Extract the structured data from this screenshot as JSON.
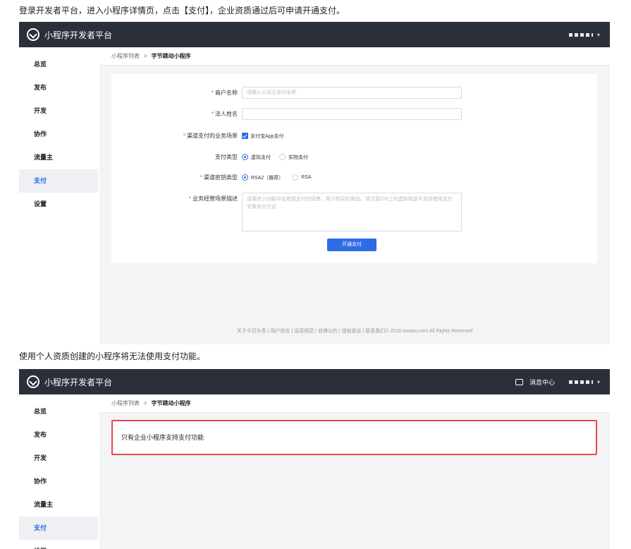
{
  "captions": {
    "first": "登录开发者平台，进入小程序详情页，点击【支付】，企业资质通过后可申请开通支付。",
    "second": "使用个人资质创建的小程序将无法使用支付功能。"
  },
  "brand": "小程序开发者平台",
  "message_center": "消息中心",
  "sidebar": [
    "总览",
    "发布",
    "开发",
    "协作",
    "流量主",
    "支付",
    "设置"
  ],
  "breadcrumb": {
    "list": "小程序列表",
    "sep": ">",
    "current": "字节跳动小程序"
  },
  "form": {
    "merchant_label": "商户名称",
    "merchant_placeholder": "请输入公司主体的全称",
    "legal_label": "法人姓名",
    "legal_value": "",
    "scene_label": "渠道支付的业务场景",
    "scene_option": "支付宝App支付",
    "paytype_label": "支付类型",
    "paytype_options": [
      "虚拟支付",
      "实物支付"
    ],
    "sign_label": "渠道密钥类型",
    "sign_options": [
      "RSA2（推荐）",
      "RSA"
    ],
    "desc_label": "业务经营场景描述",
    "desc_placeholder": "请描述小功能中会使用支付的场景、用于购买的商品、请注意iOS上的虚拟物品不支持使用支付宝等支付方式",
    "submit": "开通支付"
  },
  "footer": "关于今日头条 | 用户协议 | 运营规范 | 自律公约 | 侵权投诉 | 联系我们© 2018 toutiao.com All Rights Reserved",
  "notice": "只有企业小程序支持支付功能",
  "colors": {
    "topbar": "#2b2f3a",
    "accent": "#2e6ce6",
    "required": "#e5484d"
  }
}
